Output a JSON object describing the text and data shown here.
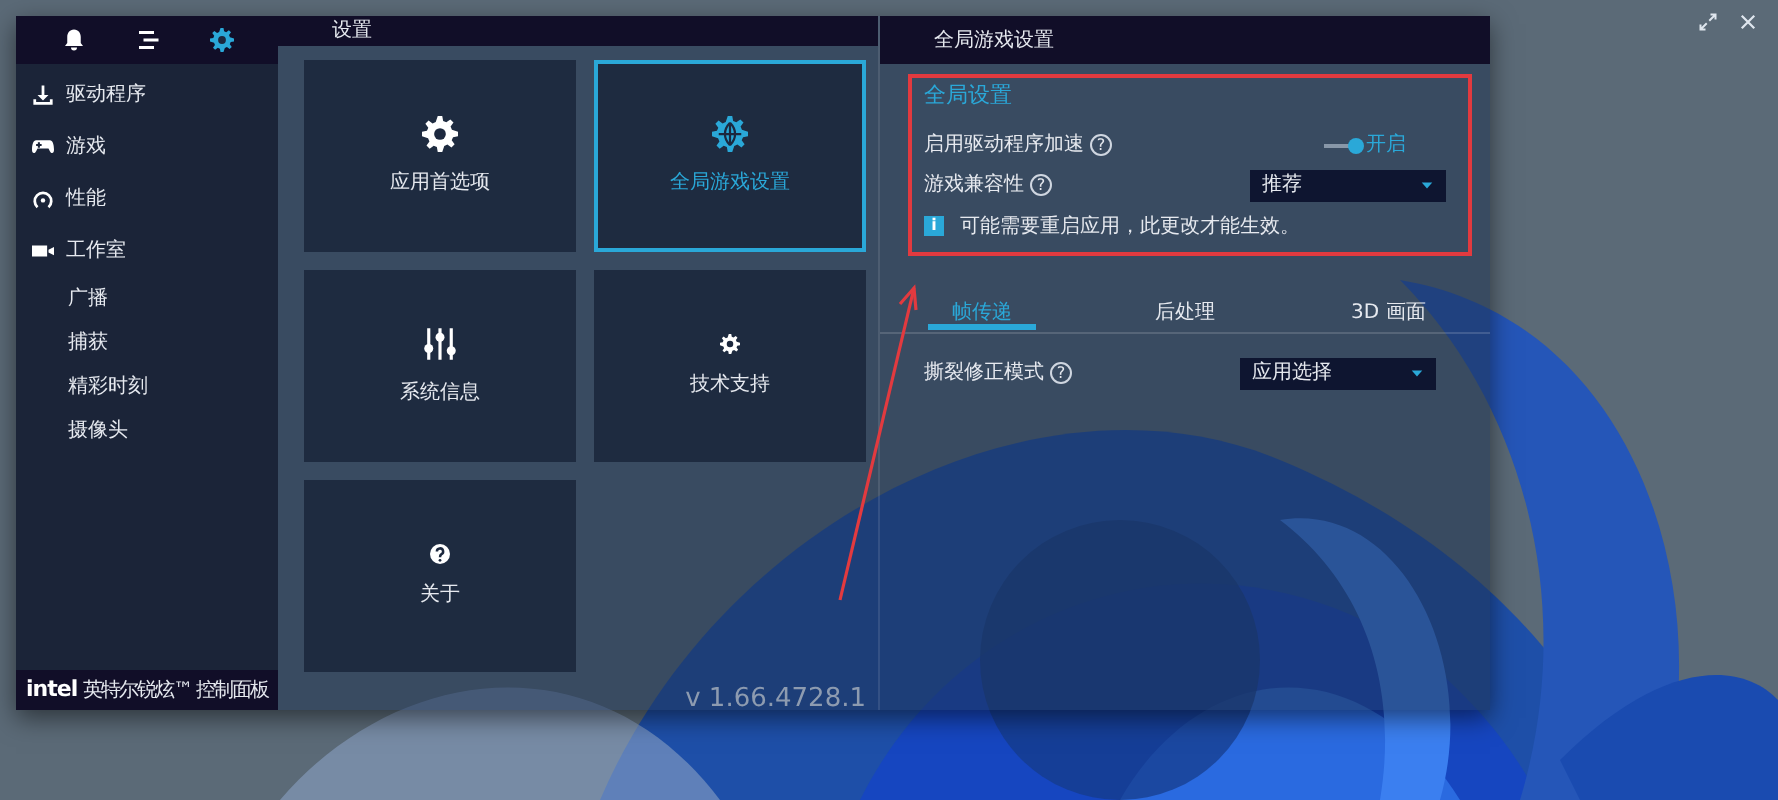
{
  "window_controls": [
    {
      "kind": "restore"
    },
    {
      "kind": "close"
    }
  ],
  "top_icons": [
    {
      "kind": "bell",
      "selected": false
    },
    {
      "kind": "menu",
      "selected": false
    },
    {
      "kind": "gear",
      "selected": true
    }
  ],
  "sidebar": {
    "items": [
      {
        "label": "驱动程序",
        "kind": "download"
      },
      {
        "label": "游戏",
        "kind": "gamepad"
      },
      {
        "label": "性能",
        "kind": "gauge"
      },
      {
        "label": "工作室",
        "kind": "camera",
        "children": [
          {
            "label": "广播"
          },
          {
            "label": "捕获"
          },
          {
            "label": "精彩时刻"
          },
          {
            "label": "摄像头"
          }
        ]
      }
    ]
  },
  "brand": {
    "logo": "intel",
    "title": "英特尔锐炫™ 控制面板"
  },
  "settings": {
    "title": "设置",
    "tiles": [
      {
        "label": "应用首选项",
        "kind": "gear",
        "selected": false
      },
      {
        "label": "全局游戏设置",
        "kind": "globe",
        "selected": true
      },
      {
        "label": "系统信息",
        "kind": "sliders",
        "selected": false
      },
      {
        "label": "技术支持",
        "kind": "support",
        "selected": false
      },
      {
        "label": "关于",
        "kind": "about",
        "selected": false
      }
    ],
    "version": "v 1.66.4728.1"
  },
  "global_panel": {
    "title": "全局游戏设置",
    "section_title": "全局设置",
    "rows": [
      {
        "kind": "toggle",
        "label": "启用驱动程序加速",
        "help": "?",
        "on": true,
        "state_text": "开启"
      },
      {
        "kind": "dropdown",
        "label": "游戏兼容性",
        "help": "?",
        "value": "推荐"
      }
    ],
    "info": {
      "icon": "i",
      "text": "可能需要重启应用，此更改才能生效。"
    },
    "tabs": [
      {
        "label": "帧传递",
        "selected": true
      },
      {
        "label": "后处理",
        "selected": false
      },
      {
        "label": "3D 画面",
        "selected": false
      }
    ],
    "tab_rows": [
      {
        "kind": "dropdown",
        "label": "撕裂修正模式",
        "help": "?",
        "value": "应用选择"
      }
    ]
  }
}
